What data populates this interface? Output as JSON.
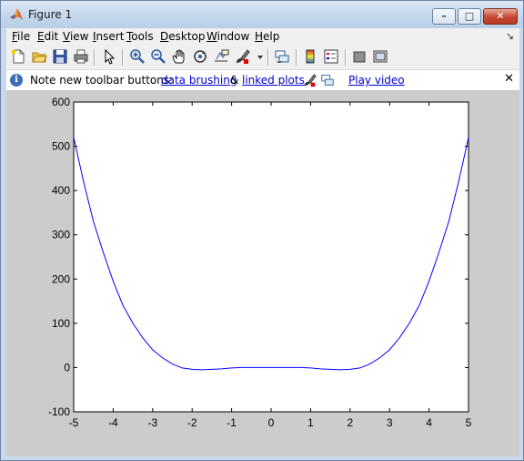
{
  "window": {
    "title": "Figure 1",
    "minimize": "–",
    "maximize": "□",
    "close": "✕"
  },
  "menu": {
    "items": [
      {
        "ul": "F",
        "rest": "ile"
      },
      {
        "ul": "E",
        "rest": "dit"
      },
      {
        "ul": "V",
        "rest": "iew"
      },
      {
        "ul": "I",
        "rest": "nsert"
      },
      {
        "ul": "T",
        "rest": "ools"
      },
      {
        "ul": "D",
        "rest": "esktop"
      },
      {
        "ul": "W",
        "rest": "indow"
      },
      {
        "ul": "H",
        "rest": "elp"
      }
    ],
    "dock_arrow": "↘"
  },
  "toolbar": {
    "icons": [
      "new-figure-icon",
      "open-file-icon",
      "save-icon",
      "print-icon",
      "edit-plot-arrow-icon",
      "zoom-in-icon",
      "zoom-out-icon",
      "pan-hand-icon",
      "rotate-3d-icon",
      "data-cursor-icon",
      "brush-icon",
      "brush-dropdown-icon",
      "link-plot-icon",
      "insert-colorbar-icon",
      "insert-legend-icon",
      "hide-plot-tools-icon",
      "show-plot-tools-icon"
    ]
  },
  "infobar": {
    "note": "Note new toolbar buttons:",
    "link_brushing": "data brushing",
    "amp": "&",
    "link_linked": "linked plots",
    "link_video": "Play video",
    "close": "✕"
  },
  "chart_data": {
    "type": "line",
    "title": "",
    "xlabel": "",
    "ylabel": "",
    "xlim": [
      -5,
      5
    ],
    "ylim": [
      -100,
      600
    ],
    "xticks": [
      "-5",
      "-4",
      "-3",
      "-2",
      "-1",
      "0",
      "1",
      "2",
      "3",
      "4",
      "5"
    ],
    "yticks": [
      "-100",
      "0",
      "100",
      "200",
      "300",
      "400",
      "500",
      "600"
    ],
    "grid": false,
    "line_color": "#0000ff",
    "series": [
      {
        "x": [
          -5,
          -4.75,
          -4.5,
          -4.25,
          -4,
          -3.75,
          -3.5,
          -3.25,
          -3,
          -2.75,
          -2.5,
          -2.25,
          -2,
          -1.75,
          -1.5,
          -1.25,
          -1,
          -0.75,
          -0.5,
          -0.25,
          0,
          0.25,
          0.5,
          0.75,
          1,
          1.25,
          1.5,
          1.75,
          2,
          2.25,
          2.5,
          2.75,
          3,
          3.25,
          3.5,
          3.75,
          4,
          4.25,
          4.5,
          4.75,
          5
        ],
        "y": [
          520,
          420,
          330,
          260,
          195,
          140,
          100,
          67,
          40,
          22,
          8,
          -1,
          -4,
          -5,
          -4,
          -3,
          -1,
          0,
          0,
          0,
          0,
          0,
          0,
          0,
          -1,
          -3,
          -4,
          -5,
          -4,
          -1,
          8,
          22,
          40,
          67,
          100,
          140,
          195,
          260,
          330,
          420,
          520
        ]
      }
    ]
  }
}
